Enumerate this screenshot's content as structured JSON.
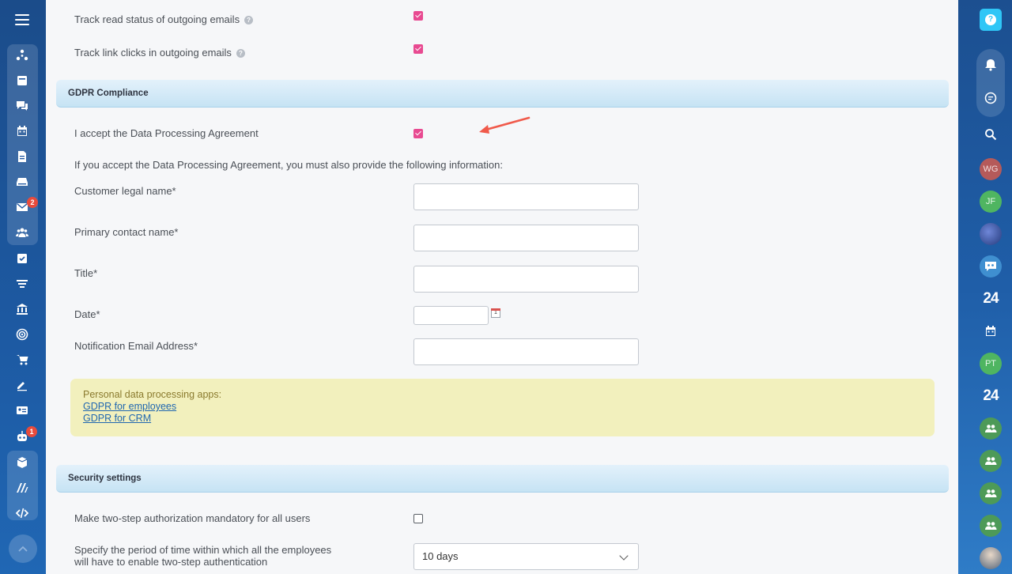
{
  "left_sidebar": {
    "icons": [
      "menu-icon",
      "sitemap-icon",
      "feed-icon",
      "chat-icon",
      "calendar-icon",
      "document-icon",
      "drive-icon",
      "mail-icon",
      "contacts-icon",
      "tasks-icon",
      "funnel-icon",
      "bank-icon",
      "target-icon",
      "cart-icon",
      "signature-icon",
      "id-card-icon",
      "robot-icon",
      "box-icon",
      "logo-m-icon",
      "code-icon"
    ],
    "mail_badge": "2",
    "robot_badge": "1"
  },
  "email_tracking": {
    "read_status_label": "Track read status of outgoing emails",
    "link_clicks_label": "Track link clicks in outgoing emails",
    "help_glyph": "?"
  },
  "gdpr": {
    "header": "GDPR Compliance",
    "accept_label": "I accept the Data Processing Agreement",
    "accept_checked": true,
    "info_text": "If you accept the Data Processing Agreement, you must also provide the following information:",
    "fields": {
      "customer_legal_name": "Customer legal name*",
      "primary_contact_name": "Primary contact name*",
      "title": "Title*",
      "date": "Date*",
      "notification_email": "Notification Email Address*"
    },
    "calendar_glyph": "1",
    "apps_note": "Personal data processing apps:",
    "app_links": [
      "GDPR for employees",
      "GDPR for CRM"
    ]
  },
  "security": {
    "header": "Security settings",
    "two_step_label": "Make two-step authorization mandatory for all users",
    "two_step_checked": false,
    "period_label_line1": "Specify the period of time within which all the employees",
    "period_label_line2": "will have to enable two-step authentication",
    "period_value": "10 days"
  },
  "right_sidebar": {
    "help_glyph": "?",
    "avatars": [
      "WG",
      "JF",
      "PT"
    ],
    "brand_24": "24"
  },
  "colors": {
    "checkbox_accent": "#e84a91",
    "section_header": "#c6e3f4",
    "note_bg": "#f2f0bd",
    "link": "#2067b0",
    "arrow": "#f05a4b"
  }
}
